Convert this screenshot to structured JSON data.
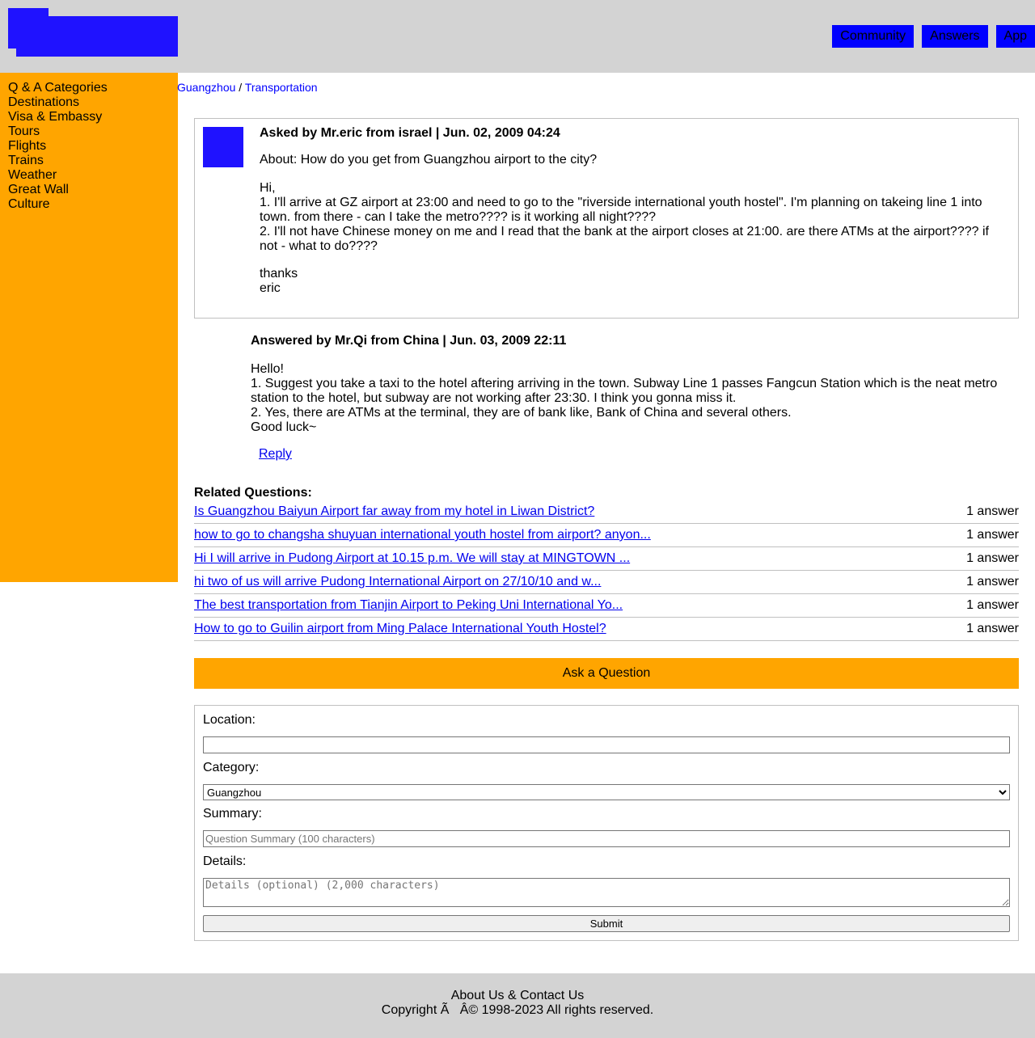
{
  "header": {
    "nav": [
      "Community",
      "Answers",
      "App"
    ]
  },
  "sidebar": {
    "items": [
      "Q & A Categories",
      "Destinations",
      "Visa & Embassy",
      "Tours",
      "Flights",
      "Trains",
      "Weather",
      "Great Wall",
      "Culture"
    ]
  },
  "breadcrumb": {
    "items": [
      "Guangzhou",
      "Transportation"
    ],
    "separator": "/"
  },
  "question": {
    "meta": "Asked by Mr.eric from israel | Jun. 02, 2009 04:24",
    "about": "About: How do you get from Guangzhou airport to the city?",
    "lines": [
      "Hi,",
      "1. I'll arrive at GZ airport at 23:00 and need to go to the \"riverside international youth hostel\". I'm planning on takeing line 1 into town. from there - can I take the metro???? is it working all night????",
      "2. I'll not have Chinese money on me and I read that the bank at the airport closes at 21:00. are there ATMs at the airport???? if not - what to do????"
    ],
    "signoff": [
      "thanks",
      "eric"
    ]
  },
  "answer": {
    "meta": "Answered by Mr.Qi from China | Jun. 03, 2009 22:11",
    "lines": [
      "Hello!",
      "1. Suggest you take a taxi to the hotel aftering arriving in the town. Subway Line 1 passes Fangcun Station which is the neat metro station to the hotel, but subway are not working after 23:30. I think you gonna miss it.",
      "2. Yes, there are ATMs at the terminal, they are of bank like, Bank of China and several others.",
      "Good luck~"
    ],
    "reply_label": "Reply"
  },
  "related": {
    "title": "Related Questions:",
    "items": [
      {
        "title": "Is Guangzhou Baiyun Airport far away from my hotel in Liwan District?",
        "count": "1 answer"
      },
      {
        "title": "how to go to changsha shuyuan international youth hostel from airport? anyon...",
        "count": "1 answer"
      },
      {
        "title": "Hi I will arrive in Pudong Airport at 10.15 p.m. We will stay at MINGTOWN ...",
        "count": "1 answer"
      },
      {
        "title": "hi two of us will arrive Pudong International Airport on 27/10/10 and w...",
        "count": "1 answer"
      },
      {
        "title": "The best transportation from Tianjin Airport to Peking Uni International Yo...",
        "count": "1 answer"
      },
      {
        "title": "How to go to Guilin airport from Ming Palace International Youth Hostel?",
        "count": "1 answer"
      }
    ]
  },
  "ask": {
    "button_label": "Ask a Question"
  },
  "form": {
    "location_label": "Location:",
    "location_value": "",
    "category_label": "Category:",
    "category_value": "Guangzhou",
    "summary_label": "Summary:",
    "summary_placeholder": "Question Summary (100 characters)",
    "details_label": "Details:",
    "details_placeholder": "Details (optional) (2,000 characters)",
    "submit_label": "Submit"
  },
  "footer": {
    "links": "About Us & Contact Us",
    "copyright": "Copyright Ã   Â© 1998-2023 All rights reserved."
  },
  "colors": {
    "header_bg": "#d3d3d3",
    "logo": "#1f12ff",
    "nav_bg": "#0000ff",
    "sidebar_bg": "#ffa500",
    "ask_bg": "#ffa500",
    "link": "#0000ee"
  }
}
